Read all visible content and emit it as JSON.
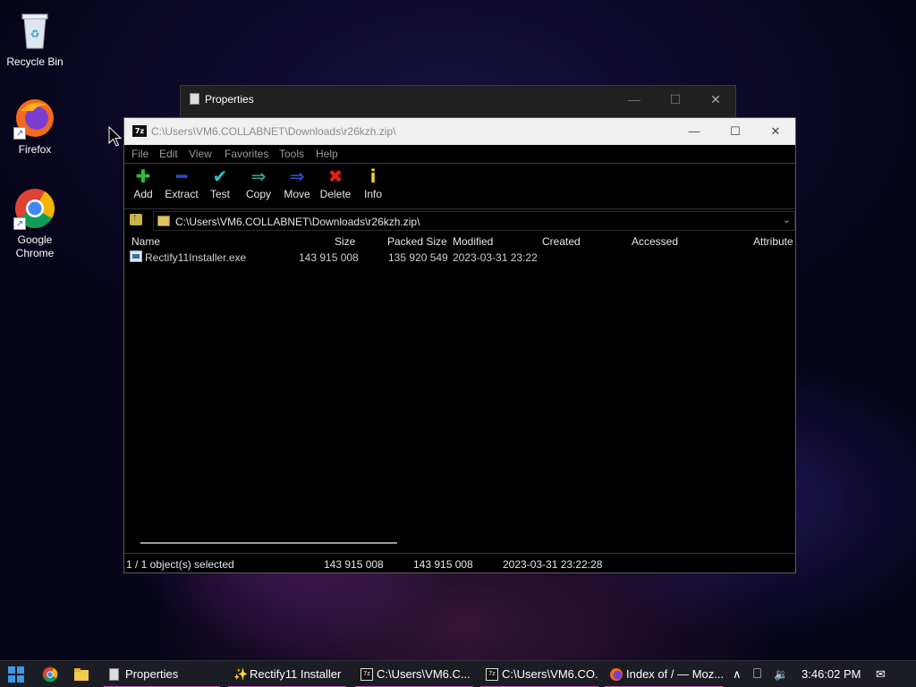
{
  "desktop": {
    "icons": [
      {
        "label": "Recycle Bin"
      },
      {
        "label": "Firefox"
      },
      {
        "label": "Google Chrome"
      }
    ]
  },
  "properties_window": {
    "title": "Properties",
    "minimize": "—",
    "maximize": "☐",
    "close": "✕"
  },
  "main_window": {
    "title": "C:\\Users\\VM6.COLLABNET\\Downloads\\r26kzh.zip\\",
    "app_icon_text": "7z",
    "minimize": "—",
    "maximize": "☐",
    "close": "✕",
    "menu": [
      "File",
      "Edit",
      "View",
      "Favorites",
      "Tools",
      "Help"
    ],
    "toolbar": [
      {
        "label": "Add",
        "icon": "plus-icon",
        "glyph": "✚",
        "color": "#27c13a"
      },
      {
        "label": "Extract",
        "icon": "minus-icon",
        "glyph": "━",
        "color": "#2a4fd8"
      },
      {
        "label": "Test",
        "icon": "check-icon",
        "glyph": "✔",
        "color": "#20c8c0"
      },
      {
        "label": "Copy",
        "icon": "copy-arrow-icon",
        "glyph": "⇒",
        "color": "#2aa39a"
      },
      {
        "label": "Move",
        "icon": "move-arrow-icon",
        "glyph": "⇒",
        "color": "#2a4fd8"
      },
      {
        "label": "Delete",
        "icon": "delete-x-icon",
        "glyph": "✖",
        "color": "#e02020"
      },
      {
        "label": "Info",
        "icon": "info-icon",
        "glyph": "i",
        "color": "#f0d020"
      }
    ],
    "address": {
      "path": "C:\\Users\\VM6.COLLABNET\\Downloads\\r26kzh.zip\\",
      "dropdown": "⌄"
    },
    "columns": [
      "Name",
      "Size",
      "Packed Size",
      "Modified",
      "Created",
      "Accessed",
      "Attribute"
    ],
    "rows": [
      {
        "name": "Rectify11Installer.exe",
        "size": "143 915 008",
        "packed_size": "135 920 549",
        "modified": "2023-03-31 23:22",
        "created": "",
        "accessed": "",
        "attributes": ""
      }
    ],
    "status": {
      "selection": "1 / 1 object(s) selected",
      "size": "143 915 008",
      "packed": "143 915 008",
      "modified": "2023-03-31 23:22:28"
    }
  },
  "taskbar": {
    "items": [
      {
        "label": "Properties"
      },
      {
        "label": "Rectify11 Installer"
      },
      {
        "label": "C:\\Users\\VM6.C..."
      },
      {
        "label": "C:\\Users\\VM6.CO..."
      },
      {
        "label": "Index of / — Moz..."
      }
    ],
    "clock": "3:46:02 PM",
    "tray_chevron": "∧",
    "volume_glyph": "🔉",
    "network_glyph": "⎕",
    "notification_glyph": "✉",
    "accent_color": "#c05fb0"
  }
}
